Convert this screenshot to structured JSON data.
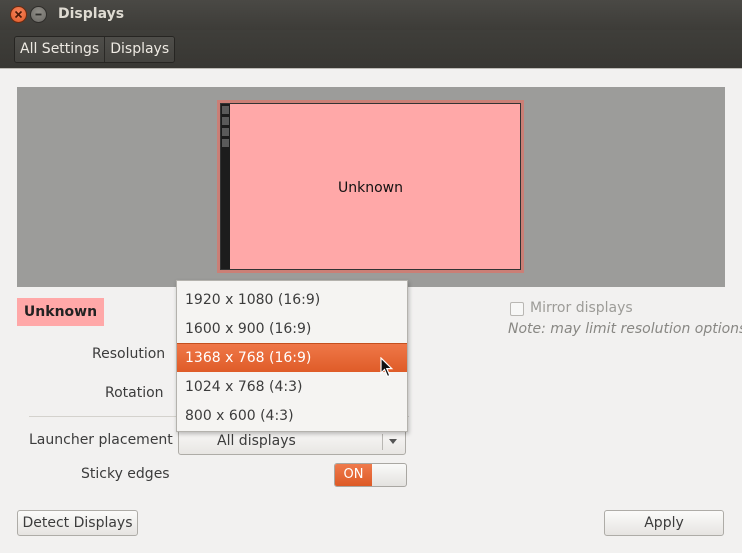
{
  "window": {
    "title": "Displays"
  },
  "breadcrumb": {
    "items": [
      "All Settings",
      "Displays"
    ]
  },
  "arrangement": {
    "monitor_label": "Unknown"
  },
  "display": {
    "name": "Unknown"
  },
  "mirror": {
    "label": "Mirror displays",
    "note": "Note: may limit resolution options",
    "checked": false
  },
  "labels": {
    "resolution": "Resolution",
    "rotation": "Rotation",
    "launcher": "Launcher placement",
    "sticky": "Sticky edges"
  },
  "resolution_dropdown": {
    "options": [
      "1920 x 1080 (16:9)",
      "1600 x 900 (16:9)",
      "1368 x 768 (16:9)",
      "1024 x 768 (4:3)",
      "800 x 600 (4:3)"
    ],
    "selected_index": 2
  },
  "launcher_combo": {
    "value": "All displays"
  },
  "sticky_switch": {
    "state": "ON"
  },
  "buttons": {
    "detect": "Detect Displays",
    "apply": "Apply"
  },
  "colors": {
    "accent": "#dd5a26",
    "monitor_fill": "#ffa8a8",
    "titlebar": "#3d3c38"
  }
}
